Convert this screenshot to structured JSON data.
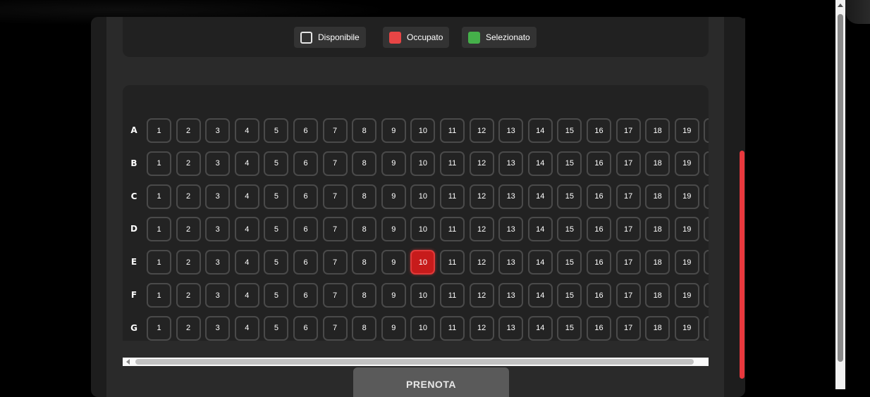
{
  "legend": {
    "items": [
      {
        "label": "Disponibile",
        "status": "available"
      },
      {
        "label": "Occupato",
        "status": "occupied"
      },
      {
        "label": "Selezionato",
        "status": "selected"
      }
    ]
  },
  "seat_map": {
    "rows": [
      "A",
      "B",
      "C",
      "D",
      "E",
      "F",
      "G"
    ],
    "visible_seat_numbers": [
      "1",
      "2",
      "3",
      "4",
      "5",
      "6",
      "7",
      "8",
      "9",
      "10",
      "11",
      "12",
      "13",
      "14",
      "15",
      "16",
      "17",
      "18",
      "19"
    ],
    "occupied": [
      {
        "row": "E",
        "seat": "10"
      }
    ]
  },
  "actions": {
    "book_label": "PRENOTA"
  },
  "colors": {
    "available_border": "#e6e6e6",
    "occupied": "#e84545",
    "selected": "#45b04a",
    "accent_scrollbar": "#e8383d"
  }
}
